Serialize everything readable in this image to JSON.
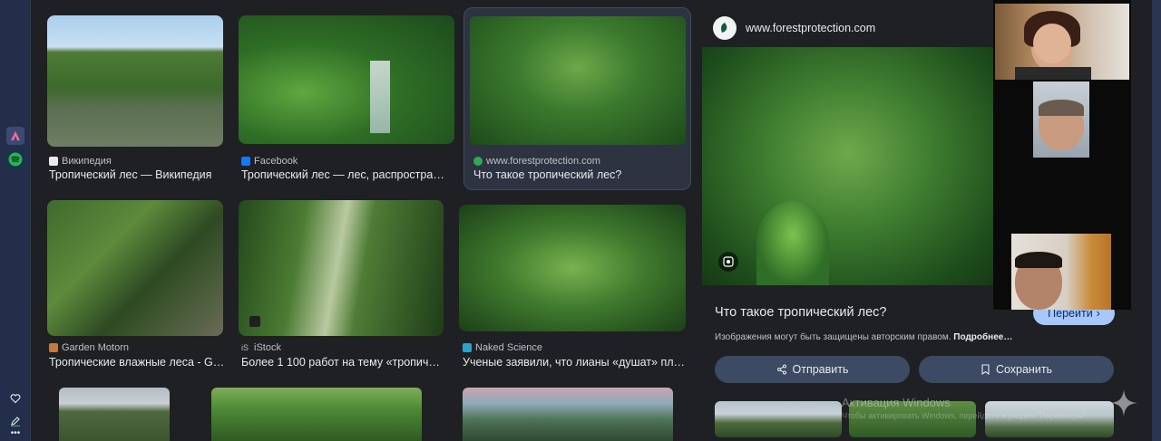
{
  "results": [
    {
      "source": "Википедия",
      "title": "Тропический лес — Википедия",
      "fav": "#e8eaed"
    },
    {
      "source": "Facebook",
      "title": "Тропический лес — лес, распростране…",
      "fav": "#1877f2"
    },
    {
      "source": "www.forestprotection.com",
      "title": "Что такое тропический лес?",
      "fav": "#34a853"
    },
    {
      "source": "Garden Motorn",
      "title": "Тропические влажные леса - G…",
      "fav": "#c47a3d"
    },
    {
      "source": "iStock",
      "title": "Более 1 100 работ на тему «тропиче…",
      "fav": "#bdc1c6"
    },
    {
      "source": "Naked Science",
      "title": "Ученые заявили, что лианы «душат» пла…",
      "fav": "#2aa3c7"
    }
  ],
  "detail": {
    "site": "www.forestprotection.com",
    "title": "Что такое тропический лес?",
    "go_label": "Перейти",
    "note": "Изображения могут быть защищены авторским правом.",
    "note_more": "Подробнее…",
    "share_label": "Отправить",
    "save_label": "Сохранить"
  },
  "watermark": {
    "line1": "Активация Windows",
    "line2": "Чтобы активировать Windows, перейдите в раздел \"Параметры\"."
  },
  "icons": {
    "rail": [
      "app-launcher-icon",
      "spotify-icon",
      "heart-icon",
      "pen-icon",
      "more-icon"
    ],
    "detail": [
      "lens-icon",
      "share-icon",
      "bookmark-icon",
      "arrow-right-icon",
      "sparkle-icon"
    ]
  },
  "colors": {
    "accent": "#a8c7fa",
    "pill": "#3c4a63",
    "selected": "#2d3340"
  }
}
